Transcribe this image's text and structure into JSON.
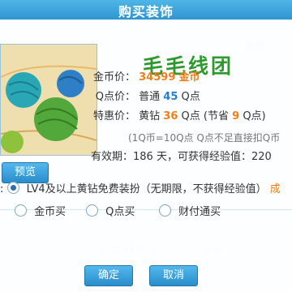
{
  "title": "购买装饰",
  "product": {
    "name": "毛毛线团"
  },
  "preview_label": "预览",
  "gold_price": {
    "label": "金币价：",
    "value": "34599",
    "unit": "金币"
  },
  "q_price": {
    "label": "Q点价：",
    "tier": "普通",
    "value": "45",
    "unit": "Q点"
  },
  "special_price": {
    "label": "特惠价：",
    "tier": "黄钻",
    "value": "36",
    "unit": "Q点",
    "save_prefix": "(节省",
    "save_value": "9",
    "save_suffix": "Q点)"
  },
  "exchange_note": "(1Q币=10Q点 Q点不足直接扣Q币",
  "validity": "有效期：186 天，可获得经验值：220",
  "options": {
    "free": "LV4及以上黄钻免费装扮（无期限，不获得经验值）",
    "gold": "金币买",
    "qpoint": "Q点买",
    "tenpay": "财付通买"
  },
  "buttons": {
    "ok": "确定",
    "cancel": "取消"
  },
  "colors": {
    "accent": "#2a8dcb",
    "price_orange": "#ef7d1a",
    "green_title": "#2e9a2e"
  }
}
